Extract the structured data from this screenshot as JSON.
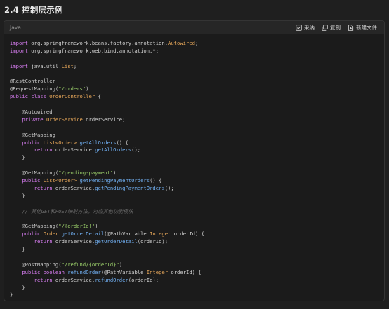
{
  "section": {
    "title": "2.4 控制层示例"
  },
  "code_block": {
    "language": "Java",
    "actions": [
      {
        "label": "采纳",
        "icon": "check-square-icon"
      },
      {
        "label": "复制",
        "icon": "copy-icon"
      },
      {
        "label": "新建文件",
        "icon": "new-file-icon"
      }
    ],
    "lines": [
      [
        [
          "kw",
          "import"
        ],
        [
          "pl",
          " org.springframework.beans.factory.annotation."
        ],
        [
          "ty",
          "Autowired"
        ],
        [
          "pl",
          ";"
        ]
      ],
      [
        [
          "kw",
          "import"
        ],
        [
          "pl",
          " org.springframework.web.bind.annotation.*;"
        ]
      ],
      [],
      [
        [
          "kw",
          "import"
        ],
        [
          "pl",
          " java.util."
        ],
        [
          "ty",
          "List"
        ],
        [
          "pl",
          ";"
        ]
      ],
      [],
      [
        [
          "an",
          "@RestController"
        ]
      ],
      [
        [
          "an",
          "@RequestMapping("
        ],
        [
          "st",
          "\"/orders\""
        ],
        [
          "an",
          ")"
        ]
      ],
      [
        [
          "kw",
          "public class"
        ],
        [
          "pl",
          " "
        ],
        [
          "ty",
          "OrderController"
        ],
        [
          "pl",
          " {"
        ]
      ],
      [],
      [
        [
          "pl",
          "    "
        ],
        [
          "an",
          "@Autowired"
        ]
      ],
      [
        [
          "pl",
          "    "
        ],
        [
          "kw",
          "private"
        ],
        [
          "pl",
          " "
        ],
        [
          "ty",
          "OrderService"
        ],
        [
          "pl",
          " orderService;"
        ]
      ],
      [],
      [
        [
          "pl",
          "    "
        ],
        [
          "an",
          "@GetMapping"
        ]
      ],
      [
        [
          "pl",
          "    "
        ],
        [
          "kw",
          "public"
        ],
        [
          "pl",
          " "
        ],
        [
          "ty",
          "List<Order>"
        ],
        [
          "pl",
          " "
        ],
        [
          "fn",
          "getAllOrders"
        ],
        [
          "pl",
          "() {"
        ]
      ],
      [
        [
          "pl",
          "        "
        ],
        [
          "kw",
          "return"
        ],
        [
          "pl",
          " orderService."
        ],
        [
          "fn",
          "getAllOrders"
        ],
        [
          "pl",
          "();"
        ]
      ],
      [
        [
          "pl",
          "    }"
        ]
      ],
      [],
      [
        [
          "pl",
          "    "
        ],
        [
          "an",
          "@GetMapping("
        ],
        [
          "st",
          "\"/pending-payment\""
        ],
        [
          "an",
          ")"
        ]
      ],
      [
        [
          "pl",
          "    "
        ],
        [
          "kw",
          "public"
        ],
        [
          "pl",
          " "
        ],
        [
          "ty",
          "List<Order>"
        ],
        [
          "pl",
          " "
        ],
        [
          "fn",
          "getPendingPaymentOrders"
        ],
        [
          "pl",
          "() {"
        ]
      ],
      [
        [
          "pl",
          "        "
        ],
        [
          "kw",
          "return"
        ],
        [
          "pl",
          " orderService."
        ],
        [
          "fn",
          "getPendingPaymentOrders"
        ],
        [
          "pl",
          "();"
        ]
      ],
      [
        [
          "pl",
          "    }"
        ]
      ],
      [],
      [
        [
          "pl",
          "    "
        ],
        [
          "cm",
          "// 其他GET和POST映射方法，对应其他功能模块"
        ]
      ],
      [],
      [
        [
          "pl",
          "    "
        ],
        [
          "an",
          "@GetMapping("
        ],
        [
          "st",
          "\"/{orderId}\""
        ],
        [
          "an",
          ")"
        ]
      ],
      [
        [
          "pl",
          "    "
        ],
        [
          "kw",
          "public"
        ],
        [
          "pl",
          " "
        ],
        [
          "ty",
          "Order"
        ],
        [
          "pl",
          " "
        ],
        [
          "fn",
          "getOrderDetail"
        ],
        [
          "pl",
          "(@PathVariable "
        ],
        [
          "ty",
          "Integer"
        ],
        [
          "pl",
          " orderId) {"
        ]
      ],
      [
        [
          "pl",
          "        "
        ],
        [
          "kw",
          "return"
        ],
        [
          "pl",
          " orderService."
        ],
        [
          "fn",
          "getOrderDetail"
        ],
        [
          "pl",
          "(orderId);"
        ]
      ],
      [
        [
          "pl",
          "    }"
        ]
      ],
      [],
      [
        [
          "pl",
          "    "
        ],
        [
          "an",
          "@PostMapping("
        ],
        [
          "st",
          "\"/refund/{orderId}\""
        ],
        [
          "an",
          ")"
        ]
      ],
      [
        [
          "pl",
          "    "
        ],
        [
          "kw",
          "public boolean"
        ],
        [
          "pl",
          " "
        ],
        [
          "fn",
          "refundOrder"
        ],
        [
          "pl",
          "(@PathVariable "
        ],
        [
          "ty",
          "Integer"
        ],
        [
          "pl",
          " orderId) {"
        ]
      ],
      [
        [
          "pl",
          "        "
        ],
        [
          "kw",
          "return"
        ],
        [
          "pl",
          " orderService."
        ],
        [
          "fn",
          "refundOrder"
        ],
        [
          "pl",
          "(orderId);"
        ]
      ],
      [
        [
          "pl",
          "    }"
        ]
      ],
      [
        [
          "pl",
          "}"
        ]
      ]
    ]
  }
}
